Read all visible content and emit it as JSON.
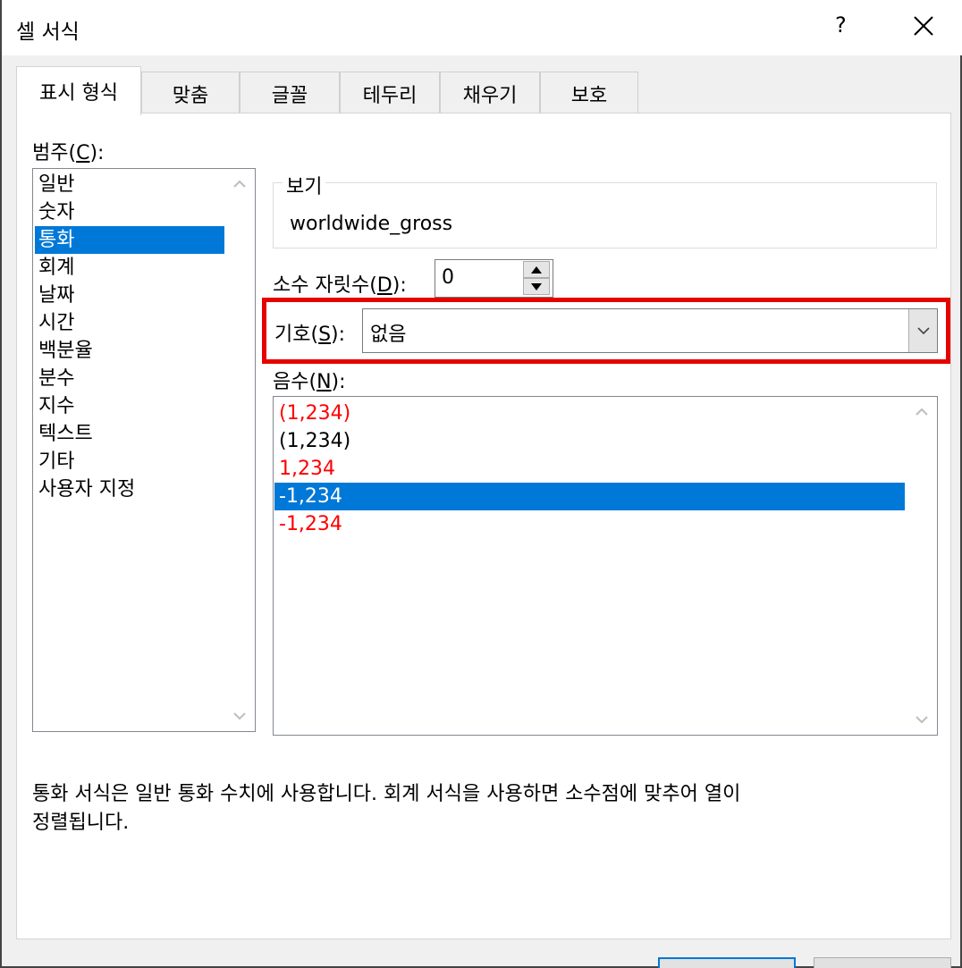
{
  "window": {
    "title": "셀 서식",
    "help_label": "?"
  },
  "tabs": [
    {
      "label": "표시 형식",
      "active": true
    },
    {
      "label": "맞춤"
    },
    {
      "label": "글꼴"
    },
    {
      "label": "테두리"
    },
    {
      "label": "채우기"
    },
    {
      "label": "보호"
    }
  ],
  "category": {
    "label": "범주",
    "mnemonic": "C",
    "items": [
      "일반",
      "숫자",
      "통화",
      "회계",
      "날짜",
      "시간",
      "백분율",
      "분수",
      "지수",
      "텍스트",
      "기타",
      "사용자 지정"
    ],
    "selected": "통화"
  },
  "sample": {
    "label": "보기",
    "value": "worldwide_gross"
  },
  "decimal_places": {
    "label": "소수 자릿수",
    "mnemonic": "D",
    "value": "0"
  },
  "symbol": {
    "label": "기호",
    "mnemonic": "S",
    "value": "없음"
  },
  "negative_numbers": {
    "label": "음수",
    "mnemonic": "N",
    "items": [
      {
        "text": "(1,234)",
        "color": "#ff0000"
      },
      {
        "text": "(1,234)",
        "color": "#000000"
      },
      {
        "text": "1,234",
        "color": "#ff0000"
      },
      {
        "text": "-1,234",
        "color": "#000000",
        "selected": true
      },
      {
        "text": "-1,234",
        "color": "#ff0000"
      }
    ]
  },
  "description": {
    "line1": "통화 서식은 일반 통화 수치에 사용합니다. 회계 서식을 사용하면 소수점에 맞추어 열이",
    "line2": "정렬됩니다."
  },
  "colors": {
    "selection": "#0078d7",
    "highlight_box": "#e60000",
    "negative_red": "#ff0000"
  }
}
